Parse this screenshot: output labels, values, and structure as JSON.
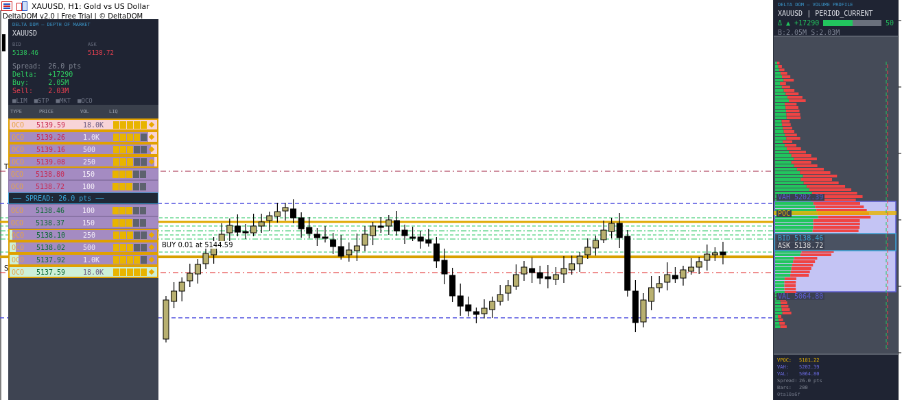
{
  "window": {
    "title": "XAUUSD, H1:  Gold vs US Dollar",
    "subtitle": "DeltaDOM v2.0 | Free Trial | © DeltaDOM"
  },
  "chart": {
    "labels": [
      {
        "kind": "tp",
        "text": "T"
      },
      {
        "kind": "entry",
        "text": "BUY 0.01 at 5144.59"
      },
      {
        "kind": "sl",
        "text": "S"
      }
    ]
  },
  "dom": {
    "title": "DELTA DOM — DEPTH OF MARKET",
    "symbol": "XAUUSD",
    "bid": {
      "label": "BID",
      "value": "5138.46"
    },
    "ask": {
      "label": "ASK",
      "value": "5138.72"
    },
    "stats": [
      {
        "label": "Spread:",
        "value": "26.0 pts",
        "kind": "muted"
      },
      {
        "label": "Delta:",
        "value": "+17290",
        "kind": "buy"
      },
      {
        "label": "Buy:",
        "value": "2.05M",
        "kind": "buy"
      },
      {
        "label": "Sell:",
        "value": "2.03M",
        "kind": "sell"
      }
    ],
    "legend": [
      "■LIM",
      "■STP",
      "■MKT",
      "■OCO"
    ],
    "columns": [
      "TYPE",
      "PRICE",
      "VOL",
      "LIQ"
    ],
    "asks": [
      {
        "type": "OCO",
        "price": "5139.59",
        "volume": "18.0K",
        "level": 1,
        "stars": 5,
        "active": true
      },
      {
        "type": "OCO",
        "price": "5139.26",
        "volume": "1.0K",
        "level": 0.06,
        "stars": 4,
        "active": true
      },
      {
        "type": "OCO",
        "price": "5139.16",
        "volume": "500",
        "level": 0.04,
        "stars": 3,
        "active": true
      },
      {
        "type": "OCO",
        "price": "5139.08",
        "volume": "250",
        "level": 0.02,
        "stars": 3,
        "active": true
      },
      {
        "type": "OCO",
        "price": "5138.80",
        "volume": "150",
        "stars": 3,
        "active": false
      },
      {
        "type": "OCO",
        "price": "5138.72",
        "volume": "100",
        "stars": 3,
        "active": false
      }
    ],
    "spread": "── SPREAD: 26.0 pts ──",
    "bids": [
      {
        "type": "OCO",
        "price": "5138.46",
        "volume": "100",
        "stars": 3,
        "active": false
      },
      {
        "type": "OCO",
        "price": "5138.37",
        "volume": "150",
        "stars": 3,
        "active": false
      },
      {
        "type": "OCO",
        "price": "5138.10",
        "volume": "250",
        "level": 0.02,
        "stars": 3,
        "active": true
      },
      {
        "type": "OCO",
        "price": "5138.02",
        "volume": "500",
        "level": 0.04,
        "stars": 3,
        "active": true
      },
      {
        "type": "OCO",
        "price": "5137.92",
        "volume": "1.0K",
        "level": 0.06,
        "stars": 4,
        "active": true
      },
      {
        "type": "OCO",
        "price": "5137.59",
        "volume": "18.0K",
        "level": 1,
        "stars": 5,
        "active": true
      }
    ]
  },
  "profile": {
    "title": "DELTA DOM — VOLUME PROFILE",
    "symbol": "XAUUSD | PERIOD_CURRENT",
    "delta": "Δ ▲ +17290",
    "ratio": {
      "level": 0.51,
      "text": "50"
    },
    "volumes": "B:2.05M  S:2.03M",
    "markers": [
      {
        "kind": "vah",
        "label": "VAH",
        "value": "5202.39"
      },
      {
        "kind": "poc",
        "label": "POC"
      },
      {
        "kind": "bid",
        "label": "BID",
        "value": "5138.46"
      },
      {
        "kind": "ask",
        "label": "ASK",
        "value": "5138.72"
      },
      {
        "kind": "val",
        "label": "VAL",
        "value": "5064.80"
      }
    ],
    "stats": [
      {
        "label": "VPOC:",
        "value": "5181.22",
        "kind": "poc"
      },
      {
        "label": "VAH:",
        "value": "5202.39",
        "kind": "va"
      },
      {
        "label": "VAL:",
        "value": "5064.80",
        "kind": "va"
      },
      {
        "label": "Spread:",
        "value": "26.0 pts",
        "kind": "muted"
      },
      {
        "label": "Bars:",
        "value": "200",
        "kind": "muted"
      }
    ],
    "footer": "0ta10a6f"
  }
}
